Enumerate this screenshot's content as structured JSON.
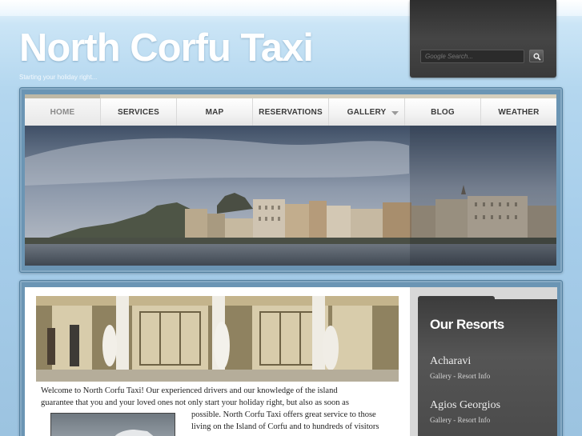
{
  "header": {
    "site_title": "North Corfu Taxi",
    "tagline": "Starting your holiday right..."
  },
  "search": {
    "placeholder": "Google Search...",
    "button_icon": "magnifier-icon"
  },
  "nav": {
    "items": [
      {
        "label": "HOME",
        "active": true
      },
      {
        "label": "SERVICES"
      },
      {
        "label": "MAP"
      },
      {
        "label": "RESERVATIONS"
      },
      {
        "label": "GALLERY",
        "has_dropdown": true
      },
      {
        "label": "BLOG"
      },
      {
        "label": "WEATHER"
      }
    ]
  },
  "content": {
    "lines": [
      "Welcome to North Corfu Taxi! Our experienced drivers and our knowledge of the island",
      "guarantee that you and your loved ones not only start your holiday right, but also as soon as",
      "possible. North Corfu Taxi offers great service to those",
      "living on the Island of Corfu and to hundreds of visitors"
    ]
  },
  "sidebar": {
    "title": "Our Resorts",
    "resorts": [
      {
        "name": "Acharavi",
        "gallery": "Gallery",
        "separator": " - ",
        "info": "Resort Info"
      },
      {
        "name": "Agios Georgios",
        "gallery": "Gallery",
        "separator": " - ",
        "info": "Resort Info"
      }
    ]
  },
  "colors": {
    "background_sky": "#a6cdea",
    "frame": "#6b95b4",
    "search_panel": "#3a3a3a",
    "nav_text": "#3b3b3b",
    "sidebar_bg": "#4a4a4a"
  }
}
